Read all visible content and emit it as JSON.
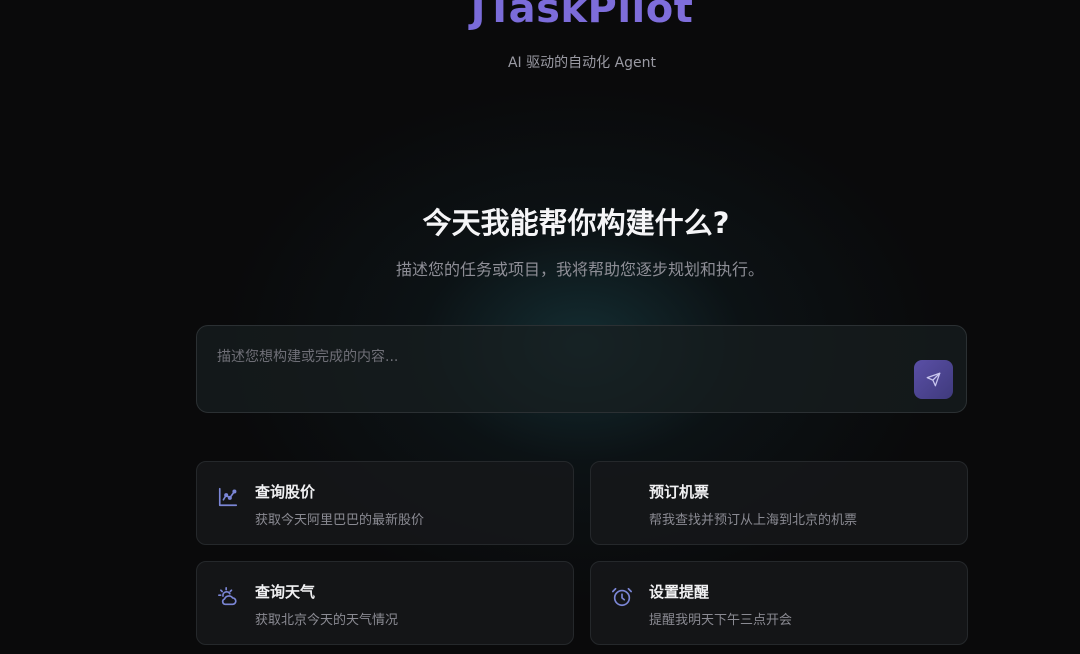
{
  "brand": {
    "title": "JTaskPilot",
    "tagline": "AI 驱动的自动化 Agent"
  },
  "hero": {
    "headline": "今天我能帮你构建什么?",
    "subline": "描述您的任务或项目，我将帮助您逐步规划和执行。"
  },
  "prompt": {
    "placeholder": "描述您想构建或完成的内容...",
    "value": "",
    "send_icon": "send-icon"
  },
  "suggestions": [
    {
      "title": "查询股价",
      "description": "获取今天阿里巴巴的最新股价",
      "icon": "chart-icon"
    },
    {
      "title": "预订机票",
      "description": "帮我查找并预订从上海到北京的机票",
      "icon": ""
    },
    {
      "title": "查询天气",
      "description": "获取北京今天的天气情况",
      "icon": "weather-icon"
    },
    {
      "title": "设置提醒",
      "description": "提醒我明天下午三点开会",
      "icon": "alarm-icon"
    }
  ],
  "colors": {
    "accent": "#7c6fd6",
    "icon": "#7b86d6",
    "background": "#0a0a0b"
  }
}
